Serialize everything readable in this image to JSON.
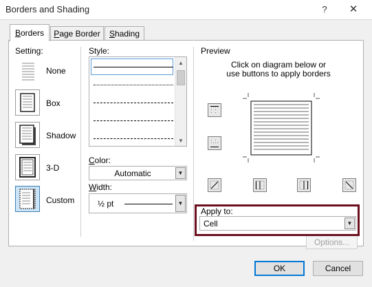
{
  "window": {
    "title": "Borders and Shading",
    "help": "?",
    "close": "✕"
  },
  "tabs": [
    {
      "label": "Borders",
      "accel": "B",
      "rest": "orders"
    },
    {
      "label": "Page Border",
      "accel": "P",
      "rest": "age Border"
    },
    {
      "label": "Shading",
      "accel": "S",
      "rest": "hading"
    }
  ],
  "setting": {
    "label": "Setting:",
    "options": [
      {
        "label": "None",
        "icon": "setting-none-icon"
      },
      {
        "label": "Box",
        "icon": "setting-box-icon"
      },
      {
        "label": "Shadow",
        "icon": "setting-shadow-icon"
      },
      {
        "label": "3-D",
        "icon": "setting-3d-icon"
      },
      {
        "label": "Custom",
        "icon": "setting-custom-icon",
        "selected": true
      }
    ]
  },
  "style": {
    "label": "Style:",
    "line_styles": [
      "solid",
      "dotted",
      "dashed-small",
      "dashed",
      "dash-dot"
    ],
    "selected": "solid"
  },
  "color": {
    "label": "Color:",
    "value": "Automatic"
  },
  "width": {
    "label": "Width:",
    "value": "½ pt"
  },
  "preview": {
    "label": "Preview",
    "instructions_line1": "Click on diagram below or",
    "instructions_line2": "use buttons to apply borders"
  },
  "apply_to": {
    "label": "Apply to:",
    "value": "Cell"
  },
  "buttons": {
    "options": "Options...",
    "ok": "OK",
    "cancel": "Cancel"
  },
  "colors": {
    "highlight": "#6b0f1f",
    "selection": "#cce4f7",
    "accent": "#0078d7"
  }
}
